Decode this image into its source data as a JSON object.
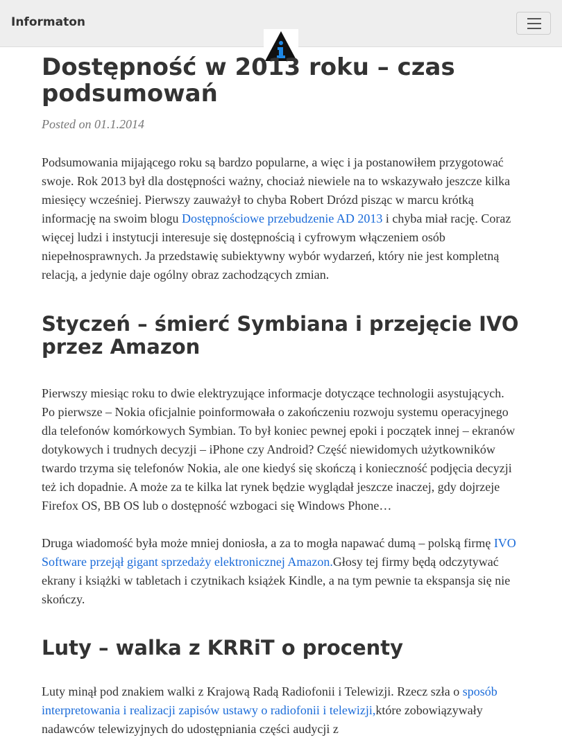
{
  "navbar": {
    "brand": "Informaton",
    "menu_icon": "hamburger-menu-icon",
    "logo_icon": "information-triangle-logo-icon"
  },
  "article": {
    "title": "Dostępność w 2013 roku – czas podsumowań",
    "meta": "Posted on 01.1.2014",
    "intro": {
      "text_before": "Podsumowania mijającego roku są bardzo popularne, a więc i ja postanowiłem przygotować swoje. Rok 2013 był dla dostępności ważny, chociaż niewiele na to wskazywało jeszcze kilka miesięcy wcześniej. Pierwszy zauważył to chyba Robert Drózd pisząc w marcu krótką informację na swoim blogu ",
      "link": "Dostępnościowe przebudzenie AD 2013",
      "text_after": " i chyba miał rację. Coraz więcej ludzi i instytucji interesuje się dostępnością i cyfrowym włączeniem osób niepełnosprawnych. Ja przedstawię subiektywny wybór wydarzeń, który nie jest kompletną relacją, a jedynie daje ogólny obraz zachodzących zmian."
    },
    "section1": {
      "heading": "Styczeń – śmierć Symbiana i przejęcie IVO przez Amazon",
      "para1": "Pierwszy miesiąc roku to dwie elektryzujące informacje dotyczące technologii asystujących. Po pierwsze – Nokia oficjalnie poinformowała o zakończeniu rozwoju systemu operacyjnego dla telefonów komórkowych Symbian. To był koniec pewnej epoki i początek innej – ekranów dotykowych i trudnych decyzji – iPhone czy Android? Część niewidomych użytkowników twardo trzyma się telefonów Nokia, ale one kiedyś się skończą i konieczność podjęcia decyzji też ich dopadnie. A może za te kilka lat rynek będzie wyglądał jeszcze inaczej, gdy dojrzeje Firefox OS, BB OS lub o dostępność wzbogaci się Windows Phone…",
      "para2_before": "Druga wiadomość była może mniej doniosła, a za to mogła napawać dumą – polską firmę ",
      "para2_link": "IVO Software przejął gigant sprzedaży elektronicznej Amazon.",
      "para2_after": "Głosy tej firmy będą odczytywać ekrany i książki w tabletach i czytnikach książek Kindle, a na tym pewnie ta ekspansja się nie skończy."
    },
    "section2": {
      "heading": "Luty – walka z KRRiT o procenty",
      "para_before": "Luty minął pod znakiem walki z Krajową Radą Radiofonii i Telewizji. Rzecz szła o ",
      "para_link": "sposób interpretowania i realizacji zapisów ustawy o radiofonii i telewizji,",
      "para_after": "które zobowiązywały nadawców telewizyjnych do udostępniania części audycji z"
    }
  }
}
